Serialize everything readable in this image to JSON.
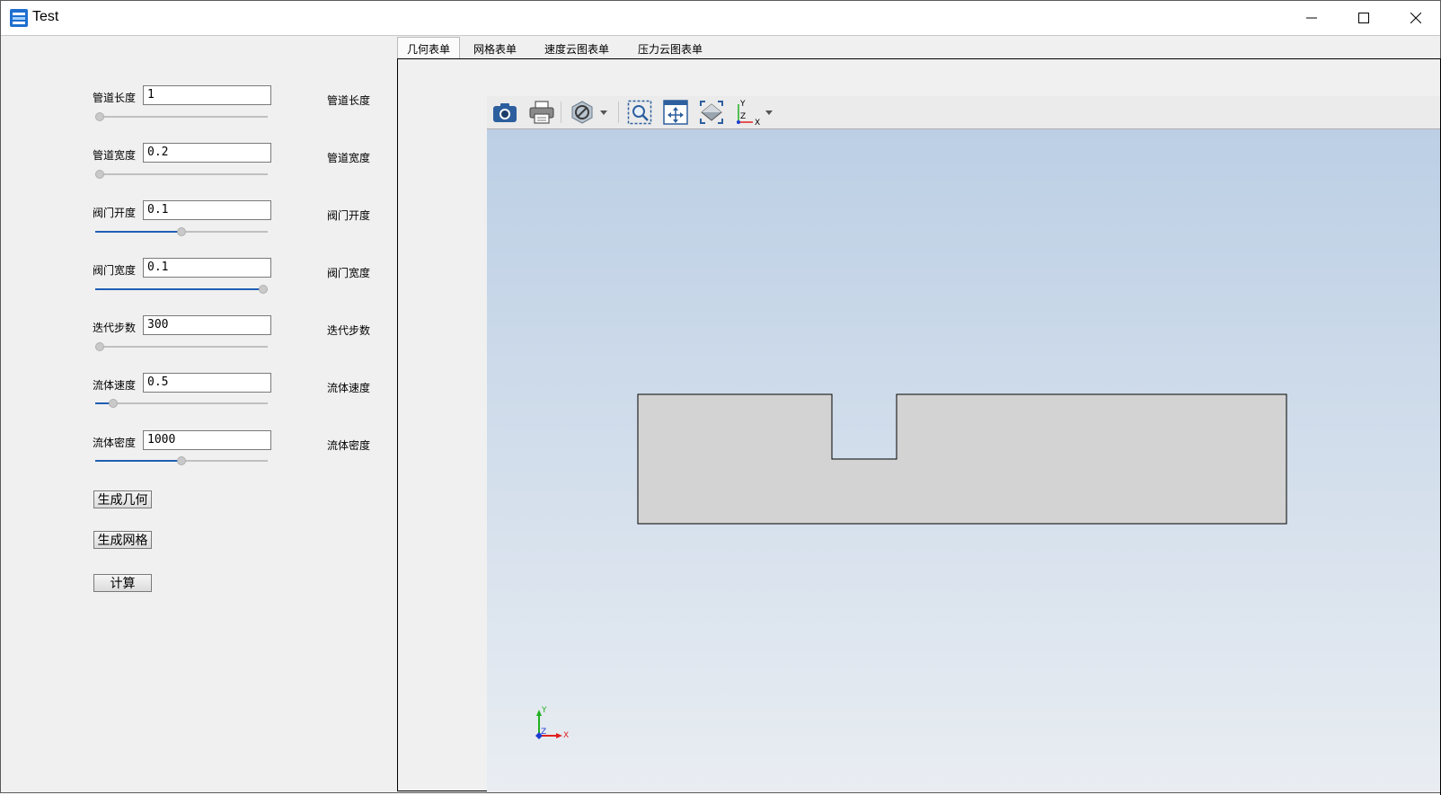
{
  "window": {
    "title": "Test",
    "controls": [
      "minimize-icon",
      "maximize-icon",
      "close-icon"
    ]
  },
  "params": [
    {
      "label": "管道长度",
      "value": "1",
      "slider": 0.0,
      "side_label": "管道长度"
    },
    {
      "label": "管道宽度",
      "value": "0.2",
      "slider": 0.0,
      "side_label": "管道宽度"
    },
    {
      "label": "阀门开度",
      "value": "0.1",
      "slider": 0.5,
      "side_label": "阀门开度"
    },
    {
      "label": "阀门宽度",
      "value": "0.1",
      "slider": 1.0,
      "side_label": "阀门宽度"
    },
    {
      "label": "迭代步数",
      "value": "300",
      "slider": 0.0,
      "side_label": "迭代步数"
    },
    {
      "label": "流体速度",
      "value": "0.5",
      "slider": 0.08,
      "side_label": "流体速度"
    },
    {
      "label": "流体密度",
      "value": "1000",
      "slider": 0.5,
      "side_label": "流体密度"
    }
  ],
  "buttons": {
    "generate_geometry": "生成几何",
    "generate_mesh": "生成网格",
    "compute": "计算"
  },
  "tabs": [
    "几何表单",
    "网格表单",
    "速度云图表单",
    "压力云图表单"
  ],
  "active_tab": 0,
  "viewer": {
    "toolbar_icons": [
      "camera-icon",
      "print-icon",
      "hide-icon",
      "zoom-box-icon",
      "pan-icon",
      "fit-view-icon",
      "axes-view-icon"
    ],
    "axes": {
      "x": "X",
      "y": "Y",
      "z": "Z"
    },
    "colors": {
      "bg_top": "#bccfe5",
      "bg_bottom": "#e9edf2",
      "geometry_fill": "#d3d3d3",
      "axis_x": "#e02020",
      "axis_y": "#20b020",
      "axis_z": "#1e3cd0"
    }
  }
}
